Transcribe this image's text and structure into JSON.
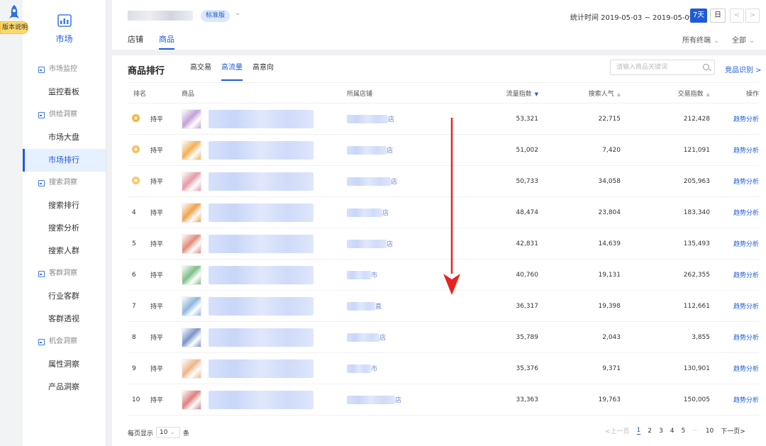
{
  "version_tag": "版本说明",
  "sidebar": {
    "module": "市场",
    "groups": [
      {
        "label": "市场监控",
        "items": [
          {
            "label": "监控看板",
            "active": false
          }
        ]
      },
      {
        "label": "供给洞察",
        "items": [
          {
            "label": "市场大盘",
            "active": false
          },
          {
            "label": "市场排行",
            "active": true
          }
        ]
      },
      {
        "label": "搜索洞察",
        "items": [
          {
            "label": "搜索排行",
            "active": false
          },
          {
            "label": "搜索分析",
            "active": false
          },
          {
            "label": "搜索人群",
            "active": false
          }
        ]
      },
      {
        "label": "客群洞察",
        "items": [
          {
            "label": "行业客群",
            "active": false
          },
          {
            "label": "客群透视",
            "active": false
          }
        ]
      },
      {
        "label": "机会洞察",
        "items": [
          {
            "label": "属性洞察",
            "active": false
          },
          {
            "label": "产品洞察",
            "active": false
          }
        ]
      }
    ]
  },
  "header": {
    "edition": "标准版",
    "stat_time": "统计时间 2019-05-03 ~ 2019-05-09",
    "range_7d": "7天",
    "range_day": "日",
    "prev": "<",
    "next": ">",
    "tabs": [
      {
        "label": "店铺",
        "active": false
      },
      {
        "label": "商品",
        "active": true
      }
    ],
    "terminal": "所有终端",
    "scope": "全部"
  },
  "panel": {
    "title": "商品排行",
    "sub_tabs": [
      {
        "label": "高交易",
        "active": false
      },
      {
        "label": "高流量",
        "active": true
      },
      {
        "label": "高意向",
        "active": false
      }
    ],
    "search_placeholder": "请输入商品关键词",
    "compete_link": "竞品识别 >",
    "columns": {
      "rank": "排名",
      "product": "商品",
      "shop": "所属店铺",
      "flow": "流量指数",
      "search": "搜索人气",
      "trade": "交易指数",
      "op": "操作"
    },
    "rows": [
      {
        "rank": "1",
        "medal": "gold",
        "trend": "持平",
        "shop_suffix": "店",
        "flow": "53,321",
        "search": "22,715",
        "trade": "212,428",
        "op": "趋势分析",
        "thumb": "#c4a3d8"
      },
      {
        "rank": "2",
        "medal": "silver",
        "trend": "持平",
        "shop_suffix": "店",
        "flow": "51,002",
        "search": "7,420",
        "trade": "121,091",
        "op": "趋势分析",
        "thumb": "#f3b055"
      },
      {
        "rank": "3",
        "medal": "bronze",
        "trend": "持平",
        "shop_suffix": "店",
        "flow": "50,733",
        "search": "34,058",
        "trade": "205,963",
        "op": "趋势分析",
        "thumb": "#e59aa7"
      },
      {
        "rank": "4",
        "medal": "",
        "trend": "持平",
        "shop_suffix": "店",
        "flow": "48,474",
        "search": "23,804",
        "trade": "183,340",
        "op": "趋势分析",
        "thumb": "#f0a24c"
      },
      {
        "rank": "5",
        "medal": "",
        "trend": "持平",
        "shop_suffix": "店",
        "flow": "42,831",
        "search": "14,639",
        "trade": "135,493",
        "op": "趋势分析",
        "thumb": "#e48b7a"
      },
      {
        "rank": "6",
        "medal": "",
        "trend": "持平",
        "shop_suffix": "市",
        "flow": "40,760",
        "search": "19,131",
        "trade": "262,355",
        "op": "趋势分析",
        "thumb": "#7fbf8a"
      },
      {
        "rank": "7",
        "medal": "",
        "trend": "持平",
        "shop_suffix": "直",
        "flow": "36,317",
        "search": "19,398",
        "trade": "112,661",
        "op": "趋势分析",
        "thumb": "#8fb6e0"
      },
      {
        "rank": "8",
        "medal": "",
        "trend": "持平",
        "shop_suffix": "店",
        "flow": "35,789",
        "search": "2,043",
        "trade": "3,855",
        "op": "趋势分析",
        "thumb": "#7d95c9"
      },
      {
        "rank": "9",
        "medal": "",
        "trend": "持平",
        "shop_suffix": "市",
        "flow": "35,376",
        "search": "9,371",
        "trade": "130,901",
        "op": "趋势分析",
        "thumb": "#f0b48a"
      },
      {
        "rank": "10",
        "medal": "",
        "trend": "持平",
        "shop_suffix": "店",
        "flow": "33,363",
        "search": "19,763",
        "trade": "150,005",
        "op": "趋势分析",
        "thumb": "#e07f7f"
      }
    ]
  },
  "pagination": {
    "per_page_label": "每页显示",
    "per_page_value": "10",
    "per_page_unit": "条",
    "prev": "<上一页",
    "pages": [
      "1",
      "2",
      "3",
      "4",
      "5",
      "···",
      "10"
    ],
    "current": "1",
    "next": "下一页>"
  },
  "colors": {
    "accent": "#1f5bd8",
    "arrow": "#e8231f",
    "medal": "#f6b33b"
  }
}
